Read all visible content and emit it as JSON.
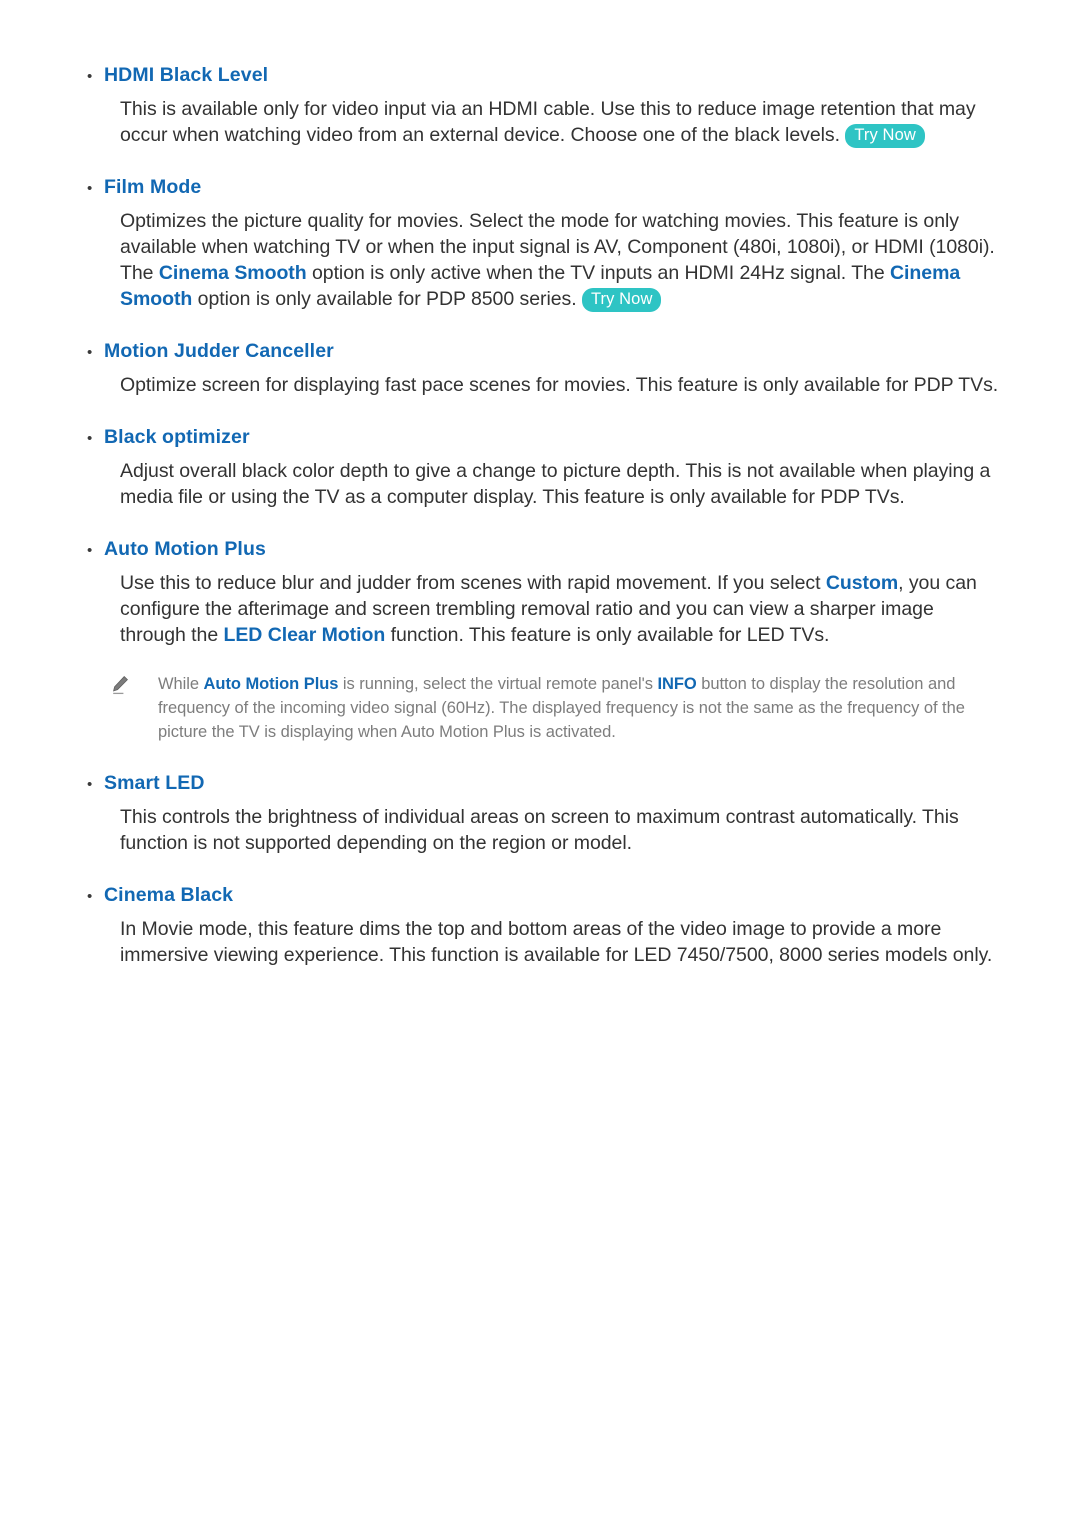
{
  "document": {
    "type": "e-manual-page",
    "accent_blue": "#1268b3",
    "body_text_color": "#333333",
    "note_text_color": "#7d7d7d",
    "badge_color": "#2ec4c4",
    "background": "#ffffff"
  },
  "sections": [
    {
      "heading": "HDMI Black Level",
      "body_1": "This is available only for video input via an HDMI cable. Use this to reduce image retention that may occur when watching video from an external device. Choose one of the black levels.",
      "badge": "Try Now"
    },
    {
      "heading": "Film Mode",
      "body_1": "Optimizes the picture quality for movies. Select the mode for watching movies. This feature is only available when watching TV or when the input signal is AV, Component (480i, 1080i), or HDMI (1080i). The ",
      "term_1": "Cinema Smooth",
      "body_2": " option is only active when the TV inputs an HDMI 24Hz signal. The ",
      "term_2": "Cinema Smooth",
      "body_3": " option is only available for PDP 8500 series.",
      "badge": "Try Now"
    },
    {
      "heading": "Motion Judder Canceller",
      "body_1": "Optimize screen for displaying fast pace scenes for movies. This feature is only available for PDP TVs."
    },
    {
      "heading": "Black optimizer",
      "body_1": "Adjust overall black color depth to give a change to picture depth. This is not available when playing a media file or using the TV as a computer display. This feature is only available for PDP TVs."
    },
    {
      "heading": "Auto Motion Plus",
      "body_1": "Use this to reduce blur and judder from scenes with rapid movement. If you select ",
      "term_1": "Custom",
      "body_2": ", you can configure the afterimage and screen trembling removal ratio and you can view a sharper image through the ",
      "term_2": "LED Clear Motion",
      "body_3": " function. This feature is only available for LED TVs."
    },
    {
      "heading": "Smart LED",
      "body_1": "This controls the brightness of individual areas on screen to maximum contrast automatically. This function is not supported depending on the region or model."
    },
    {
      "heading": "Cinema Black",
      "body_1": "In Movie mode, this feature dims the top and bottom areas of the video image to provide a more immersive viewing experience. This function is available for LED 7450/7500, 8000 series models only."
    }
  ],
  "note": {
    "icon": "pencil-icon",
    "text_1": "While ",
    "term_1": "Auto Motion Plus",
    "text_2": " is running, select the virtual remote panel's ",
    "term_2": "INFO",
    "text_3": " button to display the resolution and frequency of the incoming video signal (60Hz). The displayed frequency is not the same as the frequency of the picture the TV is displaying when Auto Motion Plus is activated."
  }
}
